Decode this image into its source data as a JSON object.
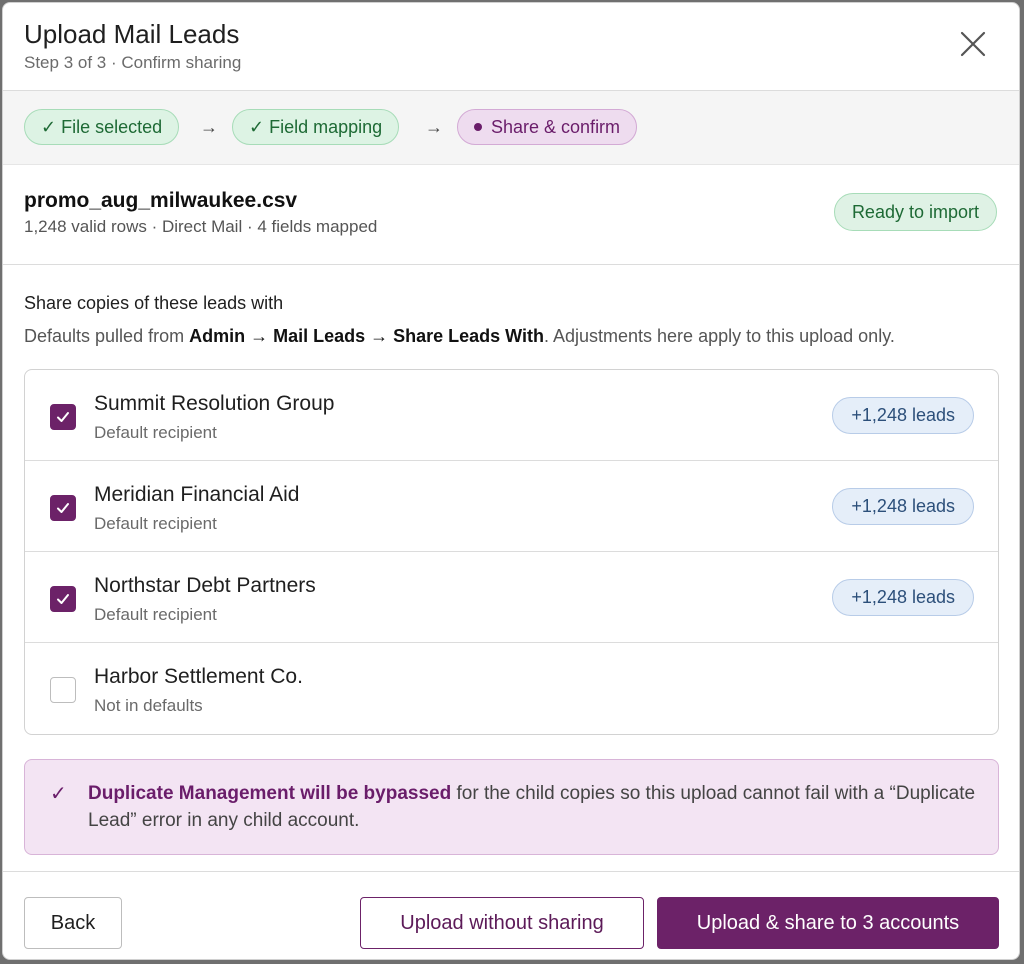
{
  "dialog": {
    "title": "Upload Mail Leads",
    "subtitle": "Step 3 of 3 · Confirm sharing"
  },
  "steps": [
    {
      "label": "✓ File selected",
      "state": "done"
    },
    {
      "label": "✓ Field mapping",
      "state": "done"
    },
    {
      "label": "Share & confirm",
      "state": "current"
    }
  ],
  "step_arrow": "→",
  "file": {
    "name": "promo_aug_milwaukee.csv",
    "meta": "1,248 valid rows · Direct Mail · 4 fields mapped",
    "status": "Ready to import"
  },
  "share": {
    "heading": "Share copies of these leads with",
    "desc_prefix": "Defaults pulled from ",
    "desc_path": "Admin → Mail Leads → Share Leads With",
    "desc_suffix": ". Adjustments here apply to this upload only.",
    "recipients": [
      {
        "name": "Summit Resolution Group",
        "sub": "Default recipient",
        "checked": true,
        "badge": "+1,248 leads"
      },
      {
        "name": "Meridian Financial Aid",
        "sub": "Default recipient",
        "checked": true,
        "badge": "+1,248 leads"
      },
      {
        "name": "Northstar Debt Partners",
        "sub": "Default recipient",
        "checked": true,
        "badge": "+1,248 leads"
      },
      {
        "name": "Harbor Settlement Co.",
        "sub": "Not in defaults",
        "checked": false,
        "badge": ""
      }
    ]
  },
  "notice": {
    "icon": "check-icon",
    "bold": "Duplicate Management will be bypassed",
    "text": " for the child copies so this upload cannot fail with a “Duplicate Lead” error in any child account."
  },
  "footer": {
    "back": "Back",
    "secondary": "Upload without sharing",
    "primary": "Upload & share to 3 accounts"
  },
  "colors": {
    "accent": "#6c2268",
    "success": "#1e6a35",
    "info": "#2c4f7a"
  }
}
